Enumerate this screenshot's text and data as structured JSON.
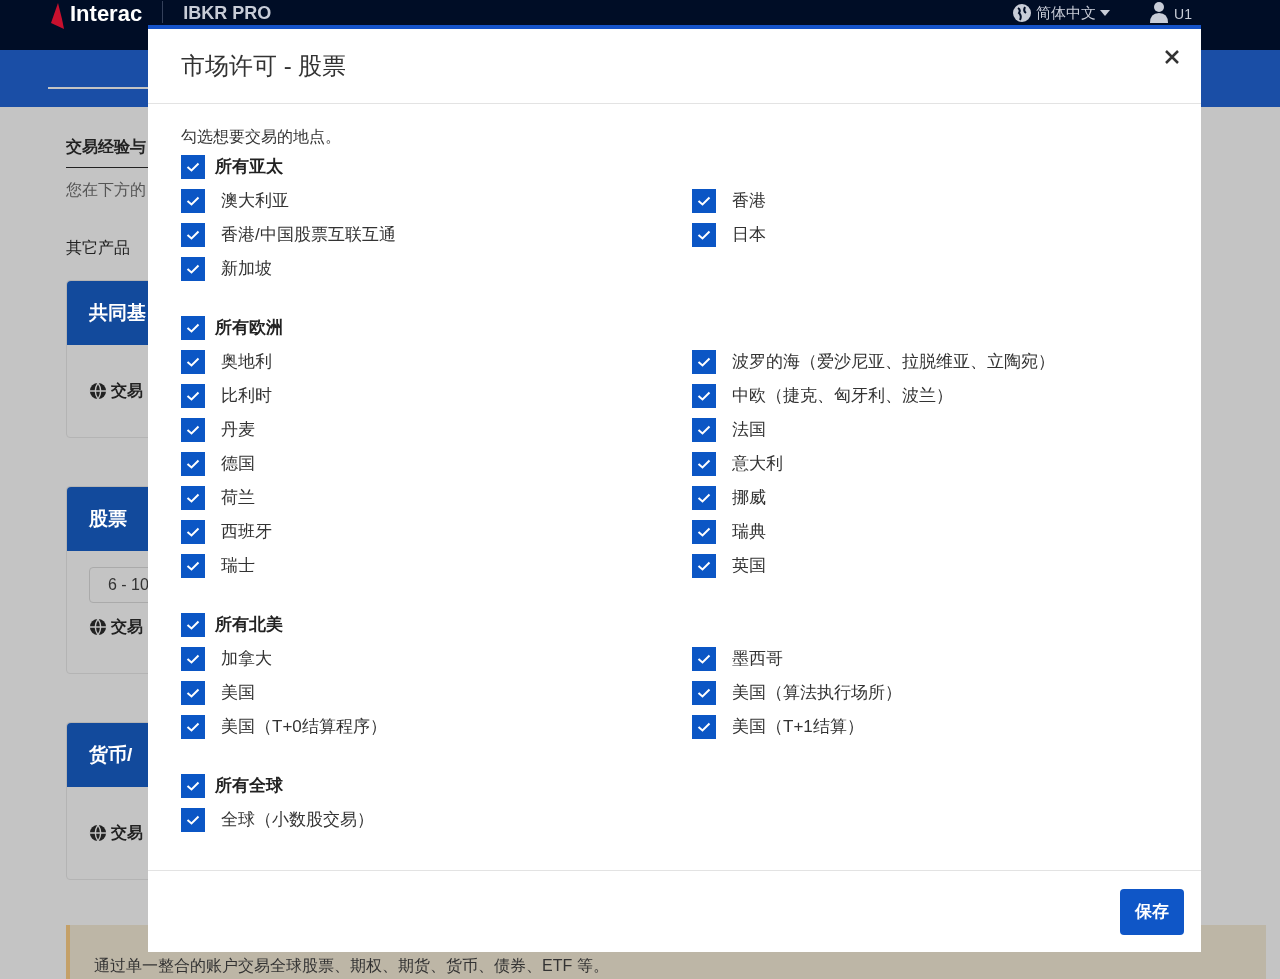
{
  "header": {
    "brand": "Interac",
    "product": "IBKR PRO",
    "language": "简体中文",
    "user": "U1"
  },
  "background": {
    "section_title": "交易经验与",
    "section_text": "您在下方的",
    "other_products": "其它产品",
    "cards": [
      {
        "title": "共同基",
        "row": "交易"
      },
      {
        "title": "股票",
        "field": "6 - 10",
        "row": "交易"
      },
      {
        "title": "货币/",
        "row": "交易"
      }
    ],
    "notice": "通过单一整合的账户交易全球股票、期权、期货、货币、债券、ETF 等。"
  },
  "dialog": {
    "title": "市场许可 - 股票",
    "intro": "勾选想要交易的地点。",
    "groups": [
      {
        "label": "所有亚太",
        "checked": true,
        "left": [
          {
            "label": "澳大利亚",
            "checked": true
          },
          {
            "label": "香港/中国股票互联互通",
            "checked": true
          },
          {
            "label": "新加坡",
            "checked": true
          }
        ],
        "right": [
          {
            "label": "香港",
            "checked": true
          },
          {
            "label": "日本",
            "checked": true
          }
        ]
      },
      {
        "label": "所有欧洲",
        "checked": true,
        "left": [
          {
            "label": "奥地利",
            "checked": true
          },
          {
            "label": "比利时",
            "checked": true
          },
          {
            "label": "丹麦",
            "checked": true
          },
          {
            "label": "德国",
            "checked": true
          },
          {
            "label": "荷兰",
            "checked": true
          },
          {
            "label": "西班牙",
            "checked": true
          },
          {
            "label": "瑞士",
            "checked": true
          }
        ],
        "right": [
          {
            "label": "波罗的海（爱沙尼亚、拉脱维亚、立陶宛）",
            "checked": true
          },
          {
            "label": "中欧（捷克、匈牙利、波兰）",
            "checked": true
          },
          {
            "label": "法国",
            "checked": true
          },
          {
            "label": "意大利",
            "checked": true
          },
          {
            "label": "挪威",
            "checked": true
          },
          {
            "label": "瑞典",
            "checked": true
          },
          {
            "label": "英国",
            "checked": true
          }
        ]
      },
      {
        "label": "所有北美",
        "checked": true,
        "left": [
          {
            "label": "加拿大",
            "checked": true
          },
          {
            "label": "美国",
            "checked": true
          },
          {
            "label": "美国（T+0结算程序）",
            "checked": true
          }
        ],
        "right": [
          {
            "label": "墨西哥",
            "checked": true
          },
          {
            "label": "美国（算法执行场所）",
            "checked": true
          },
          {
            "label": "美国（T+1结算）",
            "checked": true
          }
        ]
      },
      {
        "label": "所有全球",
        "checked": true,
        "left": [
          {
            "label": "全球（小数股交易）",
            "checked": true
          }
        ]
      }
    ],
    "save_button": "保存"
  }
}
